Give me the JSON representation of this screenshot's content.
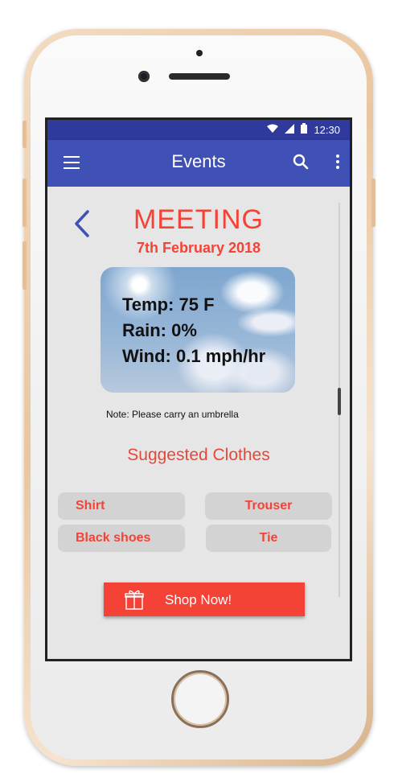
{
  "status_bar": {
    "time": "12:30"
  },
  "app_bar": {
    "title": "Events"
  },
  "event": {
    "title": "MEETING",
    "date": "7th February 2018"
  },
  "weather": {
    "temp": "Temp: 75 F",
    "rain": "Rain: 0%",
    "wind": "Wind: 0.1 mph/hr"
  },
  "note": "Note: Please carry an umbrella",
  "clothes": {
    "heading": "Suggested Clothes",
    "items": [
      "Shirt",
      "Trouser",
      "Black shoes",
      "Tie"
    ]
  },
  "shop_button": {
    "label": "Shop Now!"
  },
  "colors": {
    "primary": "#3f51b5",
    "primary_dark": "#2f3a9c",
    "accent": "#f44336",
    "chip_bg": "#d3d3d3",
    "content_bg": "#e6e6e6"
  },
  "icons": [
    "menu-icon",
    "search-icon",
    "more-vert-icon",
    "back-arrow-icon",
    "gift-icon",
    "wifi-icon",
    "signal-icon",
    "battery-icon"
  ]
}
